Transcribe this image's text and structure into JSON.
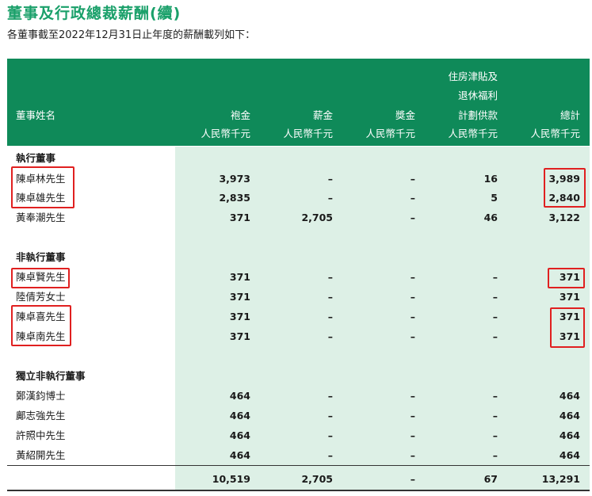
{
  "title": "董事及行政總裁薪酬(續)",
  "subtitle": "各董事截至2022年12月31日止年度的薪酬載列如下：",
  "headers": {
    "name": "董事姓名",
    "fee": "袍金",
    "fee_unit": "人民幣千元",
    "salary": "薪金",
    "salary_unit": "人民幣千元",
    "bonus": "獎金",
    "bonus_unit": "人民幣千元",
    "pension_l1": "住房津貼及",
    "pension_l2": "退休福利",
    "pension_l3": "計劃供款",
    "pension_unit": "人民幣千元",
    "total": "總計",
    "total_unit": "人民幣千元"
  },
  "sections": [
    {
      "label": "執行董事",
      "rows": [
        {
          "name": "陳卓林先生",
          "fee": "3,973",
          "salary": "–",
          "bonus": "–",
          "pension": "16",
          "total": "3,989"
        },
        {
          "name": "陳卓雄先生",
          "fee": "2,835",
          "salary": "–",
          "bonus": "–",
          "pension": "5",
          "total": "2,840"
        },
        {
          "name": "黃奉潮先生",
          "fee": "371",
          "salary": "2,705",
          "bonus": "–",
          "pension": "46",
          "total": "3,122"
        }
      ]
    },
    {
      "label": "非執行董事",
      "rows": [
        {
          "name": "陳卓賢先生",
          "fee": "371",
          "salary": "–",
          "bonus": "–",
          "pension": "–",
          "total": "371"
        },
        {
          "name": "陸倩芳女士",
          "fee": "371",
          "salary": "–",
          "bonus": "–",
          "pension": "–",
          "total": "371"
        },
        {
          "name": "陳卓喜先生",
          "fee": "371",
          "salary": "–",
          "bonus": "–",
          "pension": "–",
          "total": "371"
        },
        {
          "name": "陳卓南先生",
          "fee": "371",
          "salary": "–",
          "bonus": "–",
          "pension": "–",
          "total": "371"
        }
      ]
    },
    {
      "label": "獨立非執行董事",
      "rows": [
        {
          "name": "鄭漢鈞博士",
          "fee": "464",
          "salary": "–",
          "bonus": "–",
          "pension": "–",
          "total": "464"
        },
        {
          "name": "鄺志強先生",
          "fee": "464",
          "salary": "–",
          "bonus": "–",
          "pension": "–",
          "total": "464"
        },
        {
          "name": "許照中先生",
          "fee": "464",
          "salary": "–",
          "bonus": "–",
          "pension": "–",
          "total": "464"
        },
        {
          "name": "黃紹開先生",
          "fee": "464",
          "salary": "–",
          "bonus": "–",
          "pension": "–",
          "total": "464"
        }
      ]
    }
  ],
  "totals": {
    "fee": "10,519",
    "salary": "2,705",
    "bonus": "–",
    "pension": "67",
    "total": "13,291"
  },
  "highlight_color": "#e02020"
}
